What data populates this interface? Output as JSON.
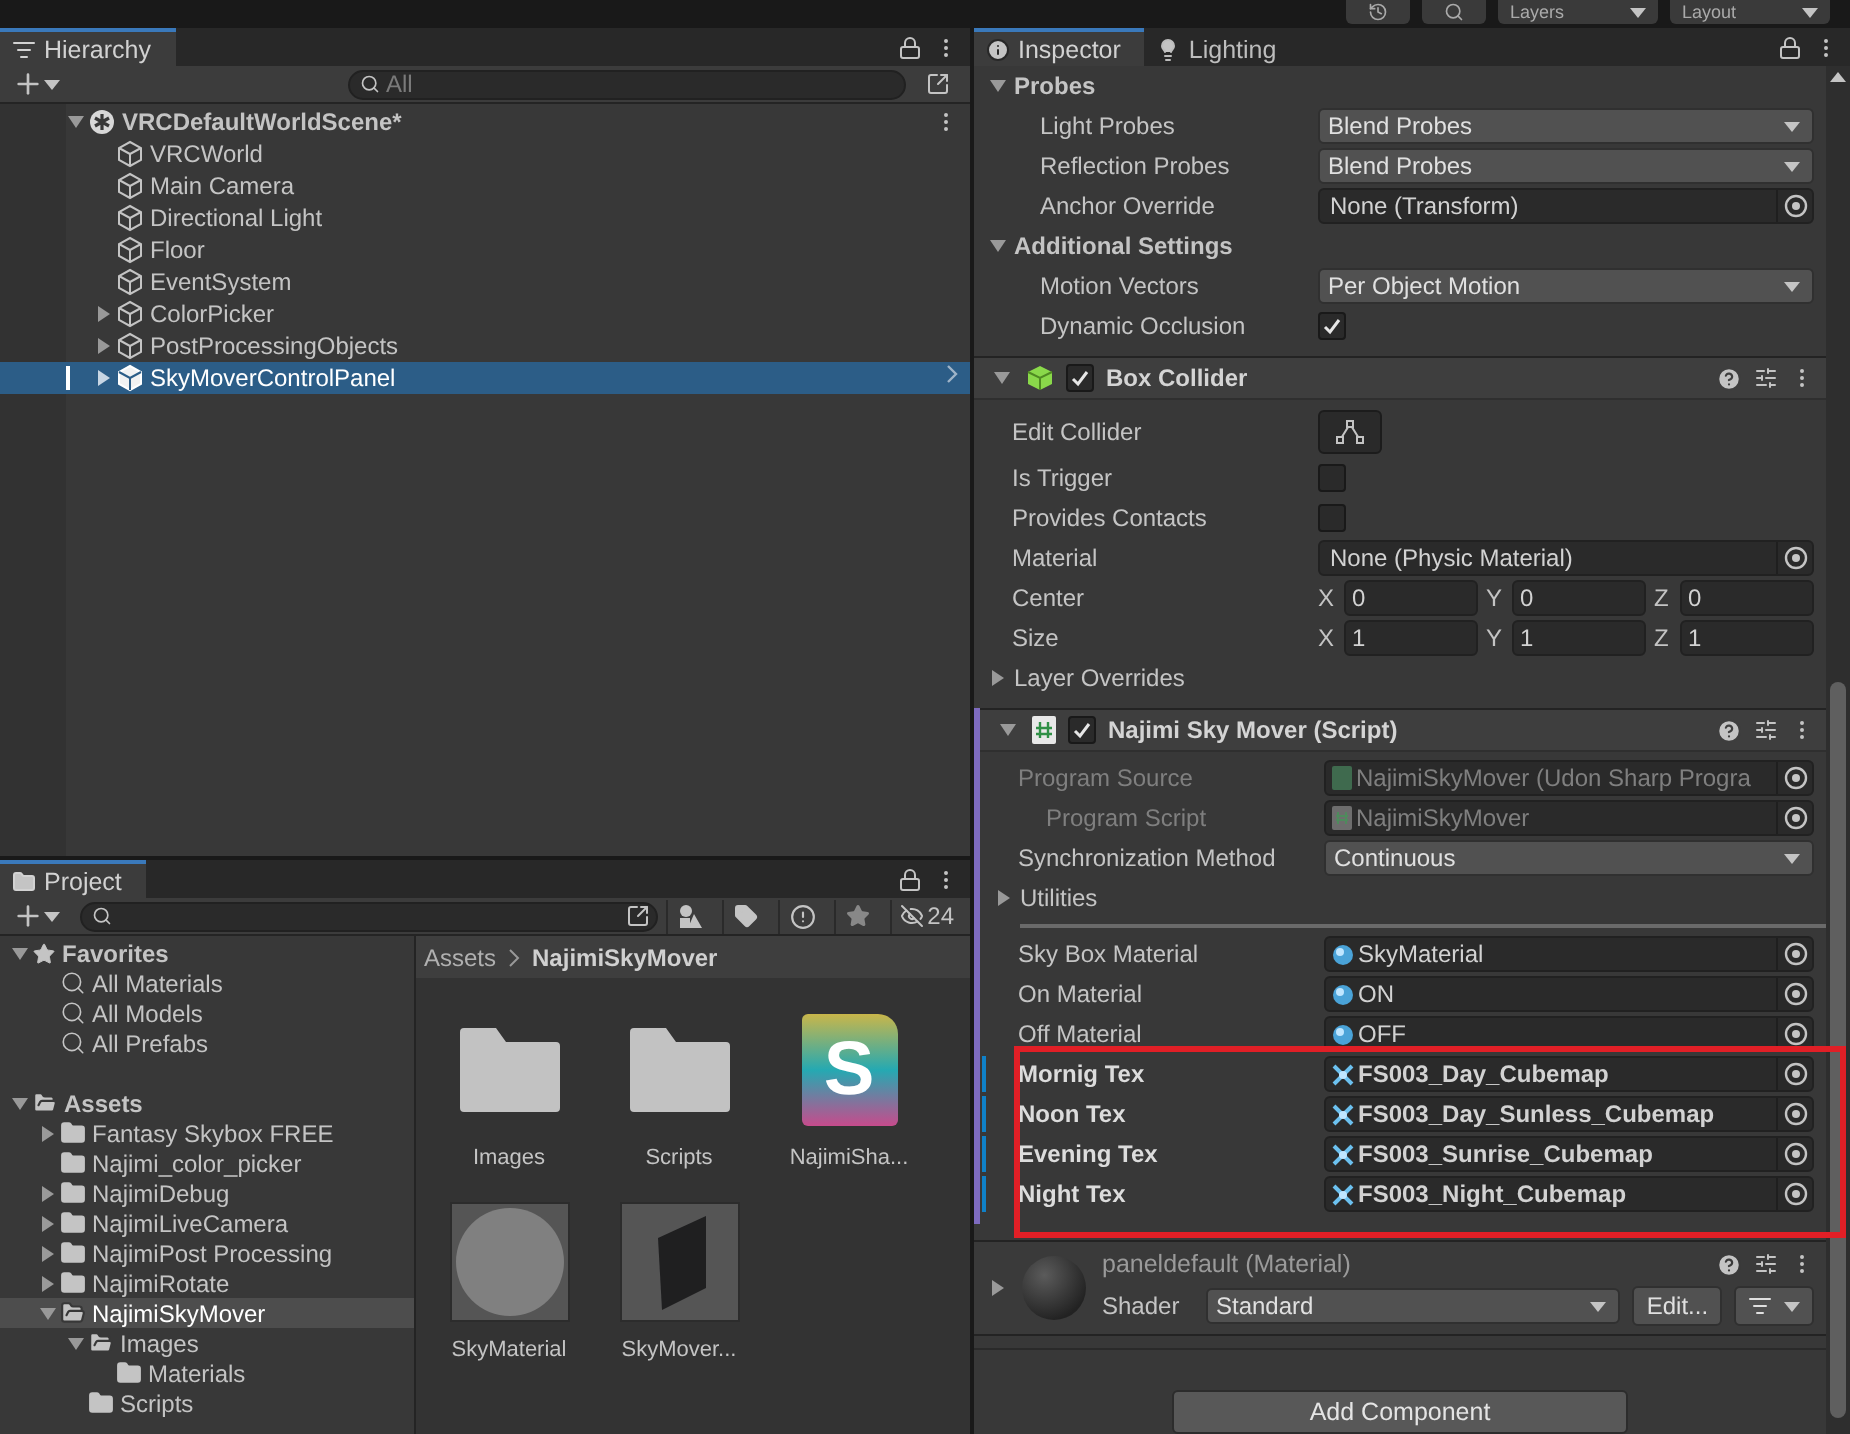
{
  "toolbar": {
    "buttons": [
      {
        "kind": "history"
      },
      {
        "kind": "search"
      },
      {
        "kind": "dropdown",
        "label": "Layers"
      },
      {
        "kind": "dropdown",
        "label": "Layout"
      }
    ]
  },
  "hierarchy": {
    "tab": "Hierarchy",
    "search": {
      "placeholder": "All"
    },
    "scene": {
      "name": "VRCDefaultWorldScene*",
      "expanded": true,
      "items": [
        {
          "name": "VRCWorld",
          "expandable": false,
          "expanded": false,
          "selected": false
        },
        {
          "name": "Main Camera",
          "expandable": false,
          "expanded": false,
          "selected": false
        },
        {
          "name": "Directional Light",
          "expandable": false,
          "expanded": false,
          "selected": false
        },
        {
          "name": "Floor",
          "expandable": false,
          "expanded": false,
          "selected": false
        },
        {
          "name": "EventSystem",
          "expandable": false,
          "expanded": false,
          "selected": false
        },
        {
          "name": "ColorPicker",
          "expandable": true,
          "expanded": false,
          "selected": false
        },
        {
          "name": "PostProcessingObjects",
          "expandable": true,
          "expanded": false,
          "selected": false
        },
        {
          "name": "SkyMoverControlPanel",
          "expandable": true,
          "expanded": false,
          "selected": true
        }
      ]
    }
  },
  "project": {
    "tab": "Project",
    "hidden_count": "24",
    "tree": [
      {
        "label": "Favorites",
        "kind": "favorites",
        "expandable": true,
        "expanded": true,
        "selected": false,
        "children": [
          {
            "label": "All Materials",
            "kind": "search",
            "expandable": false,
            "expanded": false,
            "selected": false
          },
          {
            "label": "All Models",
            "kind": "search",
            "expandable": false,
            "expanded": false,
            "selected": false
          },
          {
            "label": "All Prefabs",
            "kind": "search",
            "expandable": false,
            "expanded": false,
            "selected": false
          }
        ]
      },
      {
        "label": "Assets",
        "kind": "folder",
        "expandable": true,
        "expanded": true,
        "selected": false,
        "children": [
          {
            "label": "Fantasy Skybox FREE",
            "kind": "folder",
            "expandable": true,
            "expanded": false,
            "selected": false
          },
          {
            "label": "Najimi_color_picker",
            "kind": "folder",
            "expandable": false,
            "expanded": false,
            "selected": false
          },
          {
            "label": "NajimiDebug",
            "kind": "folder",
            "expandable": true,
            "expanded": false,
            "selected": false
          },
          {
            "label": "NajimiLiveCamera",
            "kind": "folder",
            "expandable": true,
            "expanded": false,
            "selected": false
          },
          {
            "label": "NajimiPost Processing",
            "kind": "folder",
            "expandable": true,
            "expanded": false,
            "selected": false
          },
          {
            "label": "NajimiRotate",
            "kind": "folder",
            "expandable": true,
            "expanded": false,
            "selected": false
          },
          {
            "label": "NajimiSkyMover",
            "kind": "folder",
            "expandable": true,
            "expanded": true,
            "selected": true,
            "children": [
              {
                "label": "Images",
                "kind": "folder",
                "expandable": true,
                "expanded": true,
                "selected": false,
                "children": [
                  {
                    "label": "Materials",
                    "kind": "folder",
                    "expandable": false,
                    "expanded": false,
                    "selected": false
                  }
                ]
              },
              {
                "label": "Scripts",
                "kind": "folder",
                "expandable": false,
                "expanded": false,
                "selected": false
              }
            ]
          }
        ]
      }
    ],
    "breadcrumb": [
      "Assets",
      "NajimiSkyMover"
    ],
    "assets": [
      {
        "name": "Images",
        "kind": "folder"
      },
      {
        "name": "Scripts",
        "kind": "folder"
      },
      {
        "name": "NajimiSha...",
        "kind": "shader",
        "badge": "S"
      },
      {
        "name": "SkyMaterial",
        "kind": "material"
      },
      {
        "name": "SkyMover...",
        "kind": "mesh"
      }
    ]
  },
  "inspector": {
    "tabs": [
      {
        "label": "Inspector",
        "kind": "info",
        "selected": true
      },
      {
        "label": "Lighting",
        "kind": "light",
        "selected": false
      }
    ],
    "components": [
      {
        "rows": [
          {
            "kind": "group",
            "label": "Probes",
            "expanded": true,
            "children": [
              {
                "kind": "dropdown",
                "label": "Light Probes",
                "value": "Blend Probes"
              },
              {
                "kind": "dropdown",
                "label": "Reflection Probes",
                "value": "Blend Probes"
              },
              {
                "kind": "object",
                "label": "Anchor Override",
                "value": {
                  "text": "None (Transform)"
                }
              }
            ]
          },
          {
            "kind": "group",
            "label": "Additional Settings",
            "expanded": true,
            "children": [
              {
                "kind": "dropdown",
                "label": "Motion Vectors",
                "value": "Per Object Motion"
              },
              {
                "kind": "checkbox",
                "label": "Dynamic Occlusion",
                "checked": true
              }
            ]
          }
        ]
      },
      {
        "title": "Box Collider",
        "kind": "collider",
        "enabled": true,
        "expanded": true,
        "rows": [
          {
            "kind": "edit",
            "label": "Edit Collider"
          },
          {
            "kind": "checkbox",
            "label": "Is Trigger",
            "checked": false
          },
          {
            "kind": "checkbox",
            "label": "Provides Contacts",
            "checked": false
          },
          {
            "kind": "object",
            "label": "Material",
            "value": {
              "text": "None (Physic Material)"
            }
          },
          {
            "kind": "vector",
            "label": "Center",
            "axes": [
              {
                "axis": "X",
                "value": "0"
              },
              {
                "axis": "Y",
                "value": "0"
              },
              {
                "axis": "Z",
                "value": "0"
              }
            ]
          },
          {
            "kind": "vector",
            "label": "Size",
            "axes": [
              {
                "axis": "X",
                "value": "1"
              },
              {
                "axis": "Y",
                "value": "1"
              },
              {
                "axis": "Z",
                "value": "1"
              }
            ]
          },
          {
            "kind": "foldout",
            "label": "Layer Overrides",
            "expanded": false
          }
        ]
      },
      {
        "title": "Najimi Sky Mover (Script)",
        "kind": "script",
        "enabled": true,
        "expanded": true,
        "color": "#7e6bc0",
        "rows": [
          {
            "kind": "object",
            "label": "Program Source",
            "value": {
              "kind": "program",
              "text": "NajimiSkyMover (Udon Sharp Progra"
            },
            "disabled": true,
            "children": [
              {
                "kind": "object",
                "label": "Program Script",
                "value": {
                  "kind": "script",
                  "text": "NajimiSkyMover"
                },
                "disabled": true
              }
            ]
          },
          {
            "kind": "dropdown",
            "label": "Synchronization Method",
            "value": "Continuous"
          },
          {
            "kind": "foldout",
            "label": "Utilities",
            "expanded": false
          },
          {
            "kind": "separator"
          },
          {
            "kind": "object",
            "label": "Sky Box Material",
            "value": {
              "kind": "material",
              "text": "SkyMaterial"
            },
            "overridden": false,
            "highlighted": false
          },
          {
            "kind": "object",
            "label": "On Material",
            "value": {
              "kind": "material",
              "text": "ON"
            },
            "overridden": false,
            "highlighted": false
          },
          {
            "kind": "object",
            "label": "Off Material",
            "value": {
              "kind": "material",
              "text": "OFF"
            },
            "overridden": false,
            "highlighted": false
          },
          {
            "kind": "object",
            "label": "Mornig Tex",
            "value": {
              "kind": "cubemap",
              "text": "FS003_Day_Cubemap"
            },
            "overridden": true,
            "highlighted": true
          },
          {
            "kind": "object",
            "label": "Noon Tex",
            "value": {
              "kind": "cubemap",
              "text": "FS003_Day_Sunless_Cubemap"
            },
            "overridden": true,
            "highlighted": true
          },
          {
            "kind": "object",
            "label": "Evening Tex",
            "value": {
              "kind": "cubemap",
              "text": "FS003_Sunrise_Cubemap"
            },
            "overridden": true,
            "highlighted": true
          },
          {
            "kind": "object",
            "label": "Night Tex",
            "value": {
              "kind": "cubemap",
              "text": "FS003_Night_Cubemap"
            },
            "overridden": true,
            "highlighted": true
          }
        ]
      }
    ],
    "material": {
      "name": "paneldefault (Material)",
      "shader_label": "Shader",
      "shader": "Standard",
      "edit_button": "Edit..."
    },
    "add_component": "Add Component"
  }
}
